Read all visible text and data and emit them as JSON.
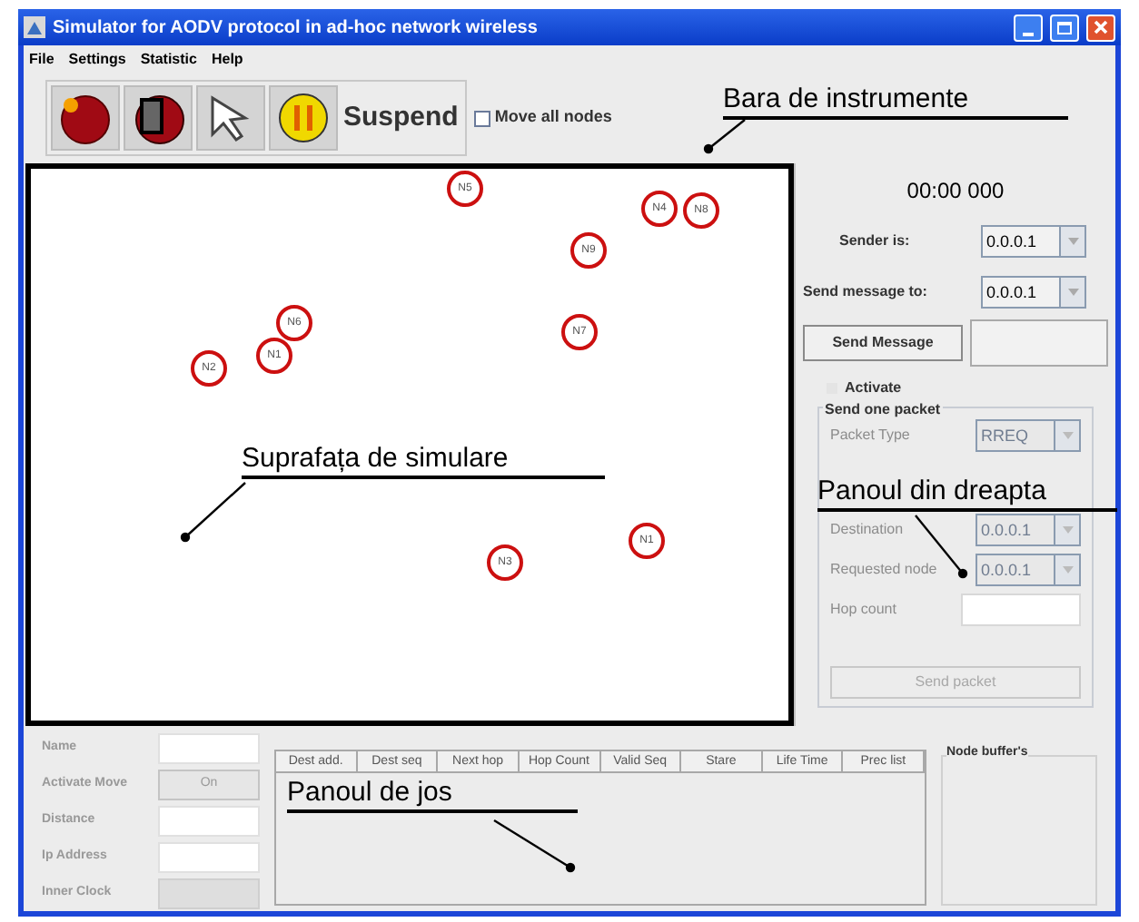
{
  "window": {
    "title": "Simulator for AODV protocol in ad-hoc network wireless"
  },
  "menu": [
    "File",
    "Settings",
    "Statistic",
    "Help"
  ],
  "tools": [
    {
      "kind": "start"
    },
    {
      "kind": "stop"
    },
    {
      "kind": "pointer"
    },
    {
      "kind": "pause",
      "label": "Suspend"
    }
  ],
  "move_all_nodes": {
    "label": "Move all nodes",
    "checked": false
  },
  "nodes": [
    "N5",
    "N4",
    "N8",
    "N9",
    "N6",
    "N1",
    "N7",
    "N2",
    "N1",
    "N3"
  ],
  "right_panel": {
    "timer": "00:00 000",
    "sender": {
      "label": "Sender is:",
      "value": "0.0.0.1"
    },
    "send_to": {
      "label": "Send message to:",
      "value": "0.0.0.1"
    },
    "send_message_button": "Send Message",
    "activate": {
      "label": "Activate",
      "checked": false
    },
    "send_one_packet": {
      "title": "Send one packet",
      "rows": [
        {
          "kind": "combo",
          "label": "Packet Type",
          "value": "RREQ",
          "disabled": true
        },
        {
          "kind": "combo",
          "label": "Destination",
          "value": "0.0.0.1",
          "disabled": true
        },
        {
          "kind": "combo",
          "label": "Requested node",
          "value": "0.0.0.1",
          "disabled": true
        },
        {
          "kind": "field",
          "label": "Hop count",
          "disabled": true
        }
      ],
      "send_button": {
        "label": "Send packet",
        "disabled": true
      }
    }
  },
  "bottom_panel": {
    "properties": [
      {
        "kind": "field",
        "label": "Name"
      },
      {
        "kind": "button",
        "label": "Activate Move",
        "value": "On"
      },
      {
        "kind": "field",
        "label": "Distance"
      },
      {
        "kind": "field",
        "label": "Ip Address"
      },
      {
        "kind": "readonly",
        "label": "Inner Clock"
      }
    ],
    "table": {
      "columns": [
        "Dest add.",
        "Dest seq",
        "Next hop",
        "Hop Count",
        "Valid Seq",
        "Stare",
        "Life Time",
        "Prec list"
      ]
    },
    "node_buffer": {
      "title": "Node buffer's"
    }
  },
  "annotations": [
    "Bara de instrumente",
    "Suprafața de simulare",
    "Panoul din dreapta",
    "Panoul de jos"
  ]
}
